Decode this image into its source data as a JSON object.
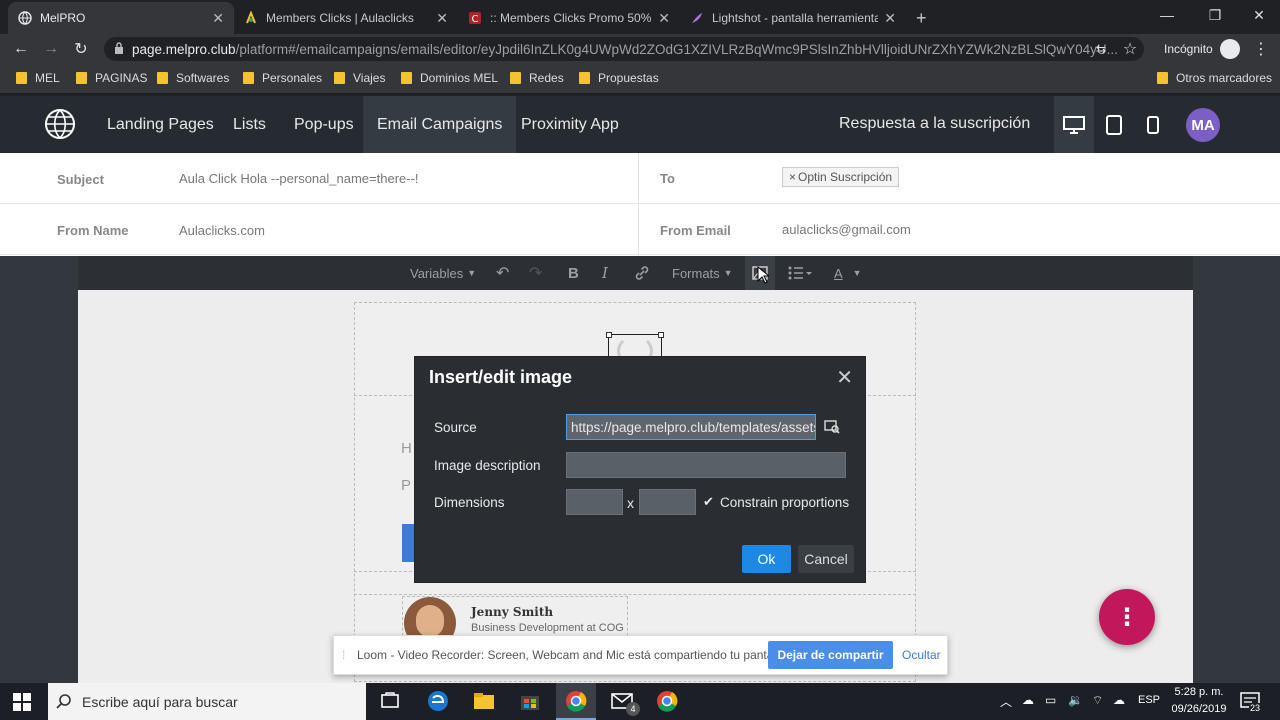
{
  "browser": {
    "tabs": [
      {
        "title": "MelPRO",
        "active": true
      },
      {
        "title": "Members Clicks | Aulaclicks",
        "active": false
      },
      {
        "title": ":: Members Clicks Promo 50% :: |",
        "active": false
      },
      {
        "title": "Lightshot - pantalla herramienta",
        "active": false
      }
    ],
    "new_tab": "+",
    "url_host": "page.melpro.club",
    "url_path": "/platform#/emailcampaigns/emails/editor/eyJpdil6InZLK0g4UWpWd2ZOdG1XZIVLRzBqWmc9PSlsInZhbHVlljoidUNrZXhYZWk2NzBLSlQwY04yU...",
    "incognito_label": "Incógnito",
    "bookmarks": [
      "MEL",
      "PAGINAS",
      "Softwares",
      "Personales",
      "Viajes",
      "Dominios MEL",
      "Redes",
      "Propuestas"
    ],
    "other_bookmarks": "Otros marcadores"
  },
  "app": {
    "nav": [
      "Landing Pages",
      "Lists",
      "Pop-ups",
      "Email Campaigns",
      "Proximity App"
    ],
    "active_nav": "Email Campaigns",
    "page_title": "Respuesta a la suscripción",
    "avatar": "MA"
  },
  "fields": {
    "subject_label": "Subject",
    "subject_value": "Aula Click Hola  --personal_name=there--!",
    "to_label": "To",
    "to_tag": "Optin Suscripción",
    "from_name_label": "From Name",
    "from_name_value": "Aulaclicks.com",
    "from_email_label": "From Email",
    "from_email_value": "aulaclicks@gmail.com"
  },
  "editor": {
    "variables": "Variables",
    "formats": "Formats",
    "partial_text_1": "H",
    "partial_text_2": "P",
    "signature_name": "Jenny Smith",
    "signature_role": "Business Development at COG"
  },
  "modal": {
    "title": "Insert/edit image",
    "source_label": "Source",
    "source_value": "https://page.melpro.club/templates/assets",
    "description_label": "Image description",
    "dimensions_label": "Dimensions",
    "times": "x",
    "constrain_label": "Constrain proportions",
    "ok": "Ok",
    "cancel": "Cancel"
  },
  "loom": {
    "message": "Loom - Video Recorder: Screen, Webcam and Mic está compartiendo tu pantalla.",
    "stop": "Dejar de compartir",
    "hide": "Ocultar"
  },
  "taskbar": {
    "search_placeholder": "Escribe aquí para buscar",
    "lang": "ESP",
    "time": "5:28 p. m.",
    "date": "09/26/2019",
    "notifications": "23",
    "mail_badge": "4"
  }
}
